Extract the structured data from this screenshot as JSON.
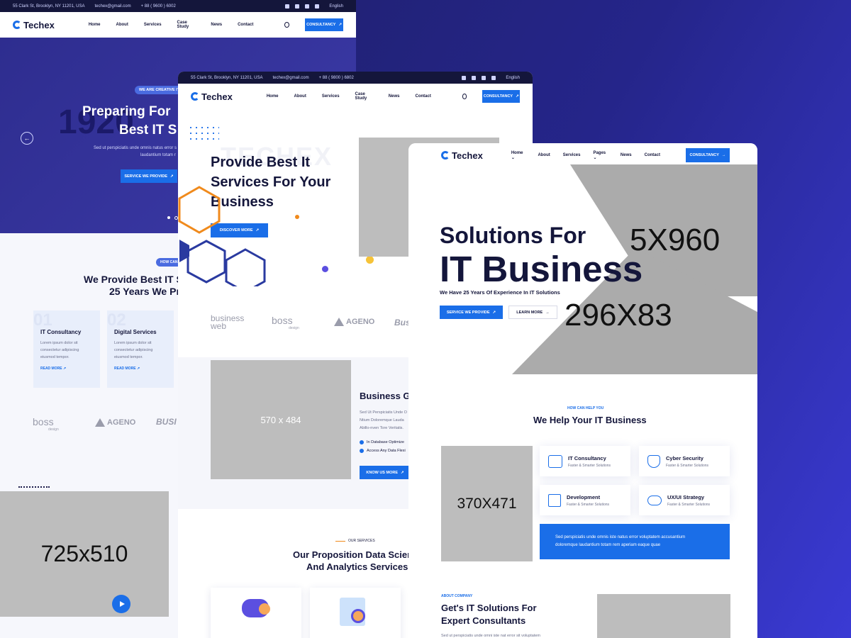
{
  "contact": {
    "address": "55 Clark St, Brooklyn, NY 11201, USA",
    "email": "techex@gmail.com",
    "phone": "+ 88 ( 9600 ) 6002",
    "phone_alt": "+ 88 ( 9800 ) 6802",
    "language": "English"
  },
  "brand": {
    "name": "Techex",
    "accent": "#1a6ee8",
    "dark": "#14163b"
  },
  "nav": {
    "home": "Home",
    "about": "About",
    "services": "Services",
    "case_study": "Case Study",
    "news": "News",
    "contact": "Contact",
    "pages": "Pages",
    "cta": "CONSULTANCY"
  },
  "demo1": {
    "tagline": "WE ARE CREATIVE IT",
    "hero_line1": "Preparing For",
    "hero_line2": "Best IT S",
    "big_number": "1920",
    "hero_text1": "Sed ut perspiciatis unde omnis natus error s",
    "hero_text2": "laudantium totam r",
    "hero_btn": "SERVICE WE PROVIDE",
    "how_badge": "HOW CAN",
    "section_title1": "We Provide Best IT S",
    "section_title2": "25 Years We Pr",
    "cards": [
      {
        "num": "01",
        "title": "IT Consultancy",
        "text1": "Lorem ipsum dolor sit",
        "text2": "consectetur adipiscing",
        "text3": "eiusmod tempor.",
        "link": "READ MORE"
      },
      {
        "num": "02",
        "title": "Digital Services",
        "text1": "Lorem ipsum dolor sit",
        "text2": "consectetur adipiscing",
        "text3": "eiusmod tempor.",
        "link": "READ MORE"
      }
    ],
    "brand1": "boss",
    "brand1_sub": "design",
    "brand2": "AGENO",
    "brand3": "BUSI",
    "video_placeholder": "725x510"
  },
  "demo2": {
    "watermark": "TECHEX",
    "hero_line1": "Provide Best It",
    "hero_line2": "Services For Your",
    "hero_line3": "Business",
    "hero_btn": "DISCOVER MORE",
    "brand1": "business",
    "brand1_b": "web",
    "brand2": "boss",
    "brand2_sub": "design",
    "brand3": "AGENO",
    "brand4": "Busi",
    "about_placeholder": "570 x 484",
    "about_title": "Business G",
    "about_text1": "Sed Ut Perspiciatis Unde O",
    "about_text2": "Ntium Doloremque Lauda",
    "about_text3": "Abillo-nven Tore Veritatis.",
    "check1": "In Database Optimize",
    "check2": "Access Any Data Flexi",
    "about_btn": "KNOW US MORE",
    "services_badge": "OUR SERVICES",
    "services_title1": "Our Proposition Data Scien",
    "services_title2": "And Analytics Services"
  },
  "demo3": {
    "hero_line1": "Solutions For",
    "hero_line2": "IT Business",
    "hero_sub": "We Have 25 Years Of Experience In IT Solutions",
    "hero_btn1": "SERVICE WE PROVIDE",
    "hero_btn2": "LEARN MORE",
    "placeholder_a": "5X960",
    "placeholder_b": "296X83",
    "help_badge": "HOW CAN HELP YOU",
    "help_title": "We Help Your IT Business",
    "side_placeholder": "370X471",
    "services": [
      {
        "title": "IT Consultancy",
        "sub": "Faster & Smarter Solutions"
      },
      {
        "title": "Cyber Security",
        "sub": "Faster & Smarter Solutions"
      },
      {
        "title": "Development",
        "sub": "Faster & Smarter Solutions"
      },
      {
        "title": "UX/UI Strategy",
        "sub": "Faster & Smarter Solutions"
      }
    ],
    "blue_text1": "Sed perspiciatis unde omnis iste natus error voluptatem accusantium",
    "blue_text2": "doloremque laudantium totam rem aperiam eaque quae",
    "about_badge": "ABOUT COMPANY",
    "about_title1": "Get's IT Solutions For",
    "about_title2": "Expert Consultants",
    "about_text": "Sed ut perspiciatis unde omni iste nat error sit voluptatem"
  }
}
